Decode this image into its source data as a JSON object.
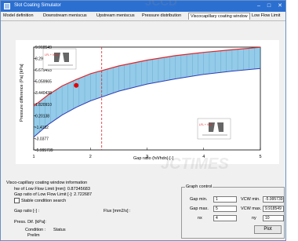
{
  "window": {
    "title": "Slot Coating Simulator",
    "minimize": "–",
    "maximize": "□",
    "close": "✕"
  },
  "tabs": [
    "Model definition",
    "Downstream meniscus",
    "Upstream meniscus",
    "Pressure distribution",
    "Viscocapillary coating window",
    "Low Flow Limit"
  ],
  "active_tab": 4,
  "chart_data": {
    "type": "area",
    "xlabel": "Gap ratio (h/t/hdn) [-]",
    "ylabel": "Pressure difference (Pa) [kPa]",
    "xlim": [
      1,
      5
    ],
    "ylim": [
      -5.995739,
      9.918549
    ],
    "x_ticks": [
      "1",
      "2",
      "3",
      "4",
      "5"
    ],
    "y_ticks": [
      "9.918549",
      "8.299021",
      "6.679493",
      "5.059965",
      "3.440438",
      "1.820910",
      "0.20138",
      "-1.4182",
      "-3.0377",
      "-5.995739"
    ],
    "upper_curve": {
      "color": "#e2262b",
      "x": [
        1.0,
        1.25,
        1.5,
        1.75,
        2.0,
        2.5,
        3.0,
        3.5,
        4.0,
        4.5,
        5.0
      ],
      "y": [
        0.8,
        2.5,
        3.9,
        4.9,
        5.8,
        7.0,
        7.9,
        8.6,
        9.1,
        9.5,
        9.9
      ]
    },
    "lower_curve": {
      "color": "#2f3db6",
      "x": [
        1.0,
        1.25,
        1.5,
        1.75,
        2.0,
        2.5,
        3.0,
        3.5,
        4.0,
        4.5,
        5.0
      ],
      "y": [
        -4.0,
        -2.1,
        -0.6,
        0.6,
        1.6,
        3.1,
        4.2,
        5.0,
        5.7,
        6.2,
        6.6
      ]
    },
    "fill_color": "#3aa0d6",
    "vertical_line": {
      "x": 2.2,
      "color": "#e2262b",
      "style": "dashed"
    },
    "point": {
      "x": 1.75,
      "y": 4.0,
      "color": "#e00000"
    },
    "annotations": [
      "LFL + VCW",
      "LFL + VCE"
    ]
  },
  "info": {
    "title": "Visco-capillary coating window information",
    "line1": "hw      of Low Flow Limit [mm]: 0.87345683",
    "line2": "Gap ratio of Low Flow Limit [-]: 2.722687",
    "stable_label": "Stable condition search",
    "gap_ratio_label": "Gap ratio [-] :",
    "flux_label": "Flux [mm2/s] :",
    "press_label": "Press. Dif. [kPa]:",
    "condition_label": "Condition :",
    "status_label": "Status",
    "prelim_label": "Prelim"
  },
  "graph_control": {
    "title": "Graph control",
    "gap_min_label": "Gap min.",
    "gap_min_value": "1",
    "gap_max_label": "Gap max.",
    "gap_max_value": "5",
    "nx_label": "nx",
    "nx_value": "4",
    "vcw_min_label": "VCW min.",
    "vcw_min_value": "-5.995739",
    "vcw_max_label": "VCW max.",
    "vcw_max_value": "9.918549",
    "ny_label": "ny",
    "ny_value": "10",
    "plot_label": "Plot"
  },
  "watermarks": [
    "JCCD",
    "JCTIMES"
  ]
}
